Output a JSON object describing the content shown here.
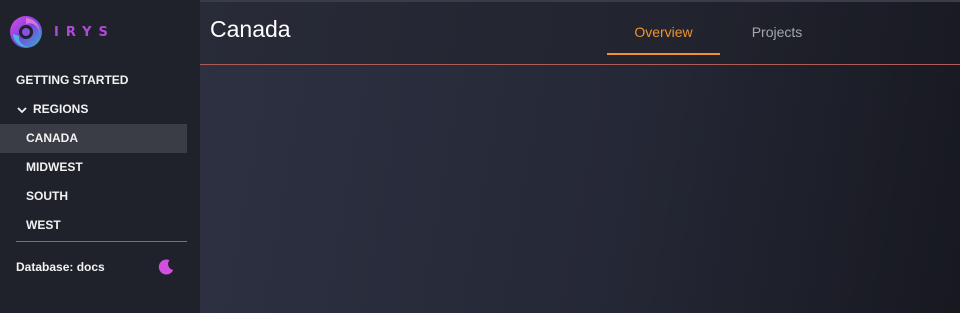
{
  "brand": {
    "name": "IRYS",
    "colors": {
      "accent": "#b04ad8",
      "tab_active": "#f0932b",
      "divider": "#b05c56"
    }
  },
  "sidebar": {
    "items": [
      {
        "label": "GETTING STARTED",
        "icon": null
      },
      {
        "label": "REGIONS",
        "icon": "chevron-down-icon",
        "expanded": true
      },
      {
        "label": "CANADA",
        "active": true
      },
      {
        "label": "MIDWEST"
      },
      {
        "label": "SOUTH"
      },
      {
        "label": "WEST"
      }
    ],
    "database_label": "Database: docs",
    "theme_icon": "moon-icon"
  },
  "header": {
    "title": "Canada",
    "tabs": [
      {
        "label": "Overview",
        "active": true
      },
      {
        "label": "Projects",
        "active": false
      }
    ]
  }
}
